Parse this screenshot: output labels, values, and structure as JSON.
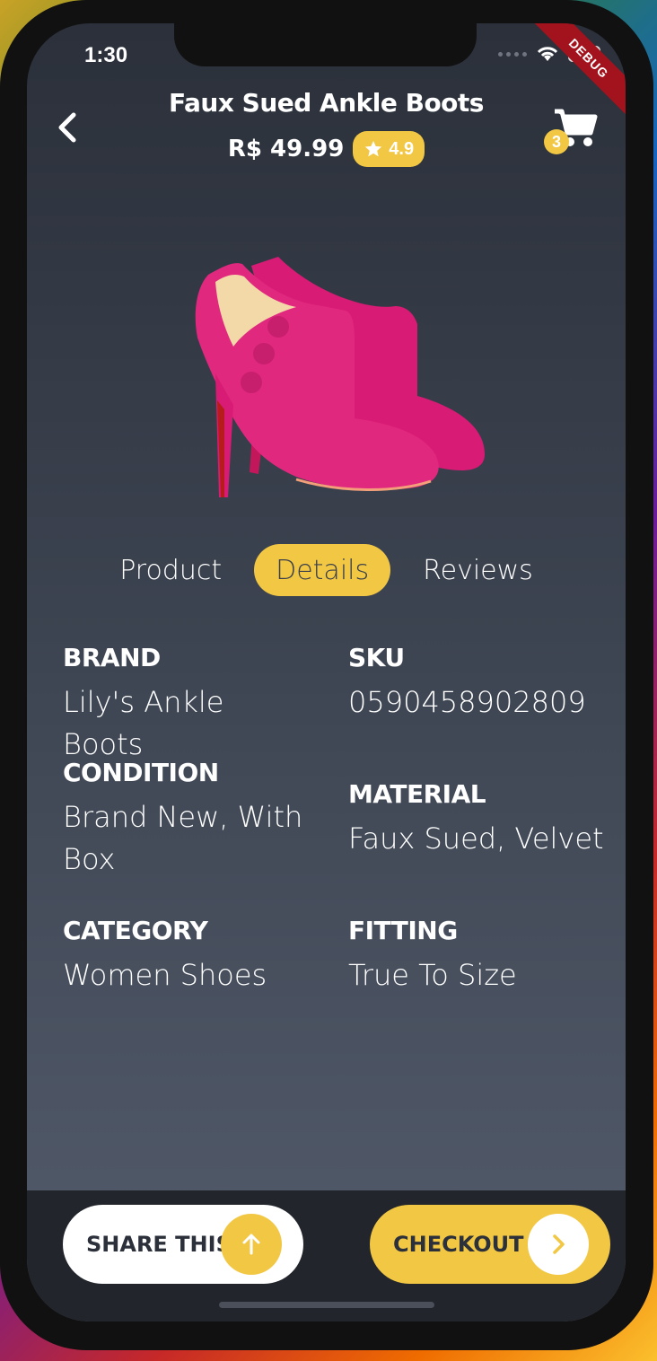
{
  "status_bar": {
    "time": "1:30",
    "debug_banner": "DEBUG"
  },
  "header": {
    "title": "Faux Sued Ankle Boots",
    "price": "R$ 49.99",
    "rating": "4.9",
    "cart_count": "3"
  },
  "tabs": [
    {
      "label": "Product",
      "active": false
    },
    {
      "label": "Details",
      "active": true
    },
    {
      "label": "Reviews",
      "active": false
    }
  ],
  "details": {
    "brand": {
      "label": "BRAND",
      "value": "Lily's Ankle Boots"
    },
    "sku": {
      "label": "SKU",
      "value": "0590458902809"
    },
    "condition": {
      "label": "CONDITION",
      "value": "Brand New, With Box"
    },
    "material": {
      "label": "MATERIAL",
      "value": "Faux Sued, Velvet"
    },
    "category": {
      "label": "CATEGORY",
      "value": "Women Shoes"
    },
    "fitting": {
      "label": "FITTING",
      "value": "True To Size"
    }
  },
  "actions": {
    "share_label": "SHARE THIS",
    "checkout_label": "CHECKOUT"
  },
  "colors": {
    "accent": "#f2c744",
    "background_top": "#2b303a",
    "background_bottom": "#535c6c",
    "bottom_bar": "#22252c",
    "product": "#e0287f"
  }
}
